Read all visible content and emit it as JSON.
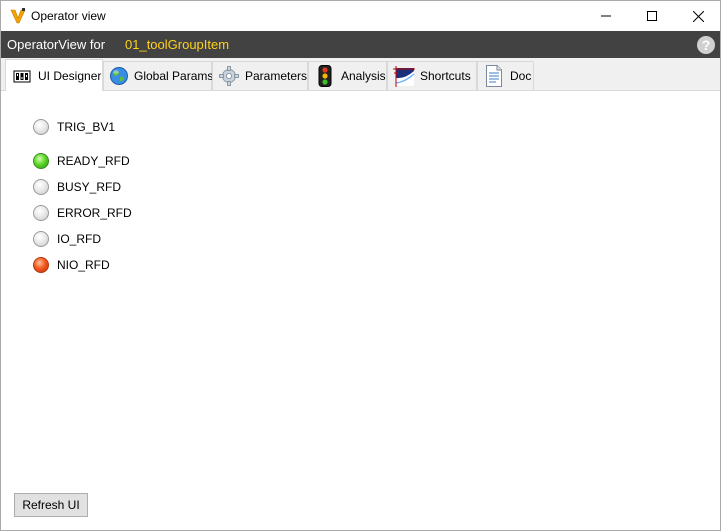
{
  "window": {
    "title": "Operator view",
    "app_icon": "vi-logo-icon"
  },
  "header": {
    "label": "OperatorView for",
    "tool_name": "01_toolGroupItem",
    "help_glyph": "?"
  },
  "tabs": [
    {
      "label": "UI Designer",
      "icon": "ui-designer-icon",
      "active": true
    },
    {
      "label": "Global Params",
      "icon": "globe-icon",
      "active": false
    },
    {
      "label": "Parameters",
      "icon": "gear-icon",
      "active": false
    },
    {
      "label": "Analysis",
      "icon": "traffic-light-icon",
      "active": false
    },
    {
      "label": "Shortcuts",
      "icon": "shortcuts-icon",
      "active": false
    },
    {
      "label": "Doc",
      "icon": "document-icon",
      "active": false
    }
  ],
  "indicators": [
    {
      "label": "TRIG_BV1",
      "state": "off"
    },
    {
      "label": "READY_RFD",
      "state": "green"
    },
    {
      "label": "BUSY_RFD",
      "state": "off"
    },
    {
      "label": "ERROR_RFD",
      "state": "off"
    },
    {
      "label": "IO_RFD",
      "state": "off"
    },
    {
      "label": "NIO_RFD",
      "state": "red"
    }
  ],
  "footer": {
    "refresh_label": "Refresh UI"
  },
  "colors": {
    "header_bg": "#424242",
    "tool_name": "#ffd21a",
    "led_green": "#5fd62c",
    "led_red": "#f25a1e"
  }
}
